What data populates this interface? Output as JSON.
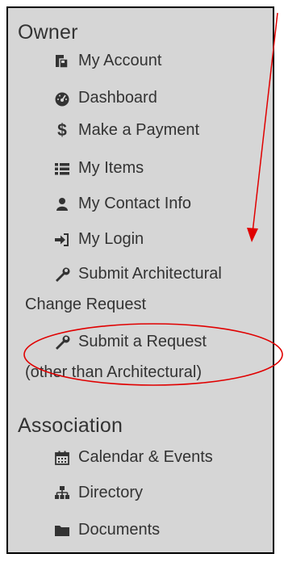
{
  "sections": {
    "owner": {
      "title": "Owner",
      "items": [
        {
          "label": "My Account",
          "icon": "account-icon"
        },
        {
          "label": "Dashboard",
          "icon": "dashboard-icon"
        },
        {
          "label": "Make a Payment",
          "icon": "dollar-icon"
        },
        {
          "label": "My Items",
          "icon": "list-icon"
        },
        {
          "label": "My Contact Info",
          "icon": "user-icon"
        },
        {
          "label": "My Login",
          "icon": "sign-in-icon"
        },
        {
          "label": "Submit Architectural",
          "label_line2": "Change Request",
          "icon": "wrench-icon"
        },
        {
          "label": "Submit a Request",
          "label_line2": "(other than Architectural)",
          "icon": "wrench-icon"
        }
      ]
    },
    "association": {
      "title": "Association",
      "items": [
        {
          "label": "Calendar & Events",
          "icon": "calendar-icon"
        },
        {
          "label": "Directory",
          "icon": "sitemap-icon"
        },
        {
          "label": "Documents",
          "icon": "folder-icon"
        }
      ]
    }
  },
  "annotation": {
    "color": "#e00000"
  },
  "colors": {
    "panel_bg": "#d6d6d6",
    "text": "#333333"
  }
}
